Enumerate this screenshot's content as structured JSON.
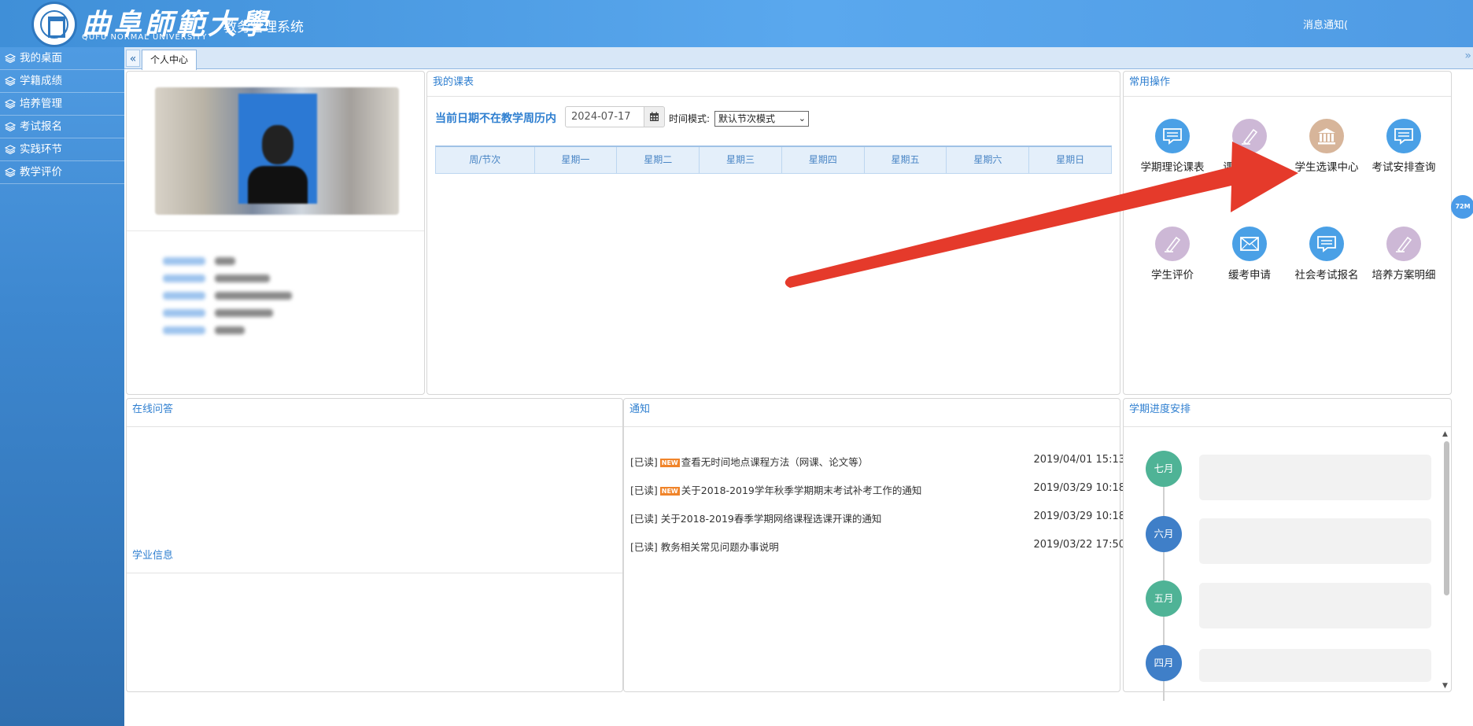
{
  "header": {
    "logo_cn": "曲阜師範大學",
    "logo_en": "QUFU NORMAL UNIVERSITY",
    "system_title": "教务管理系统",
    "message_notice": "消息通知("
  },
  "sidebar": {
    "items": [
      {
        "label": "我的桌面"
      },
      {
        "label": "学籍成绩"
      },
      {
        "label": "培养管理"
      },
      {
        "label": "考试报名"
      },
      {
        "label": "实践环节"
      },
      {
        "label": "教学评价"
      }
    ]
  },
  "tabs": {
    "collapse_glyph": "«",
    "active_label": "个人中心",
    "right_glyph": "»"
  },
  "schedule": {
    "title": "我的课表",
    "week_message": "当前日期不在教学周历内",
    "date_value": "2024-07-17",
    "time_mode_label": "时间模式:",
    "time_mode_selected": "默认节次模式",
    "columns": [
      "周/节次",
      "星期一",
      "星期二",
      "星期三",
      "星期四",
      "星期五",
      "星期六",
      "星期日"
    ]
  },
  "common_ops": {
    "title": "常用操作",
    "items": [
      {
        "label": "学期理论课表",
        "icon": "message-icon",
        "color": "#4aa0e6"
      },
      {
        "label": "课程成绩查",
        "icon": "pen-icon",
        "color": "#cdb8d6"
      },
      {
        "label": "学生选课中心",
        "icon": "bank-icon",
        "color": "#d7b59a"
      },
      {
        "label": "考试安排查询",
        "icon": "message-icon",
        "color": "#4aa0e6"
      },
      {
        "label": "学生评价",
        "icon": "pen-icon",
        "color": "#cdb8d6"
      },
      {
        "label": "缓考申请",
        "icon": "mail-icon",
        "color": "#4aa0e6"
      },
      {
        "label": "社会考试报名",
        "icon": "message-icon",
        "color": "#4aa0e6"
      },
      {
        "label": "培养方案明细",
        "icon": "pen-icon",
        "color": "#cdb8d6"
      }
    ]
  },
  "qa": {
    "title": "在线问答"
  },
  "academic": {
    "title": "学业信息"
  },
  "notices": {
    "title": "通知",
    "items": [
      {
        "status": "[已读]",
        "is_new": true,
        "new_label": "NEW",
        "text": "查看无时间地点课程方法（网课、论文等）",
        "date": "2019/04/01 15:13"
      },
      {
        "status": "[已读]",
        "is_new": true,
        "new_label": "NEW",
        "text": "关于2018-2019学年秋季学期期末考试补考工作的通知",
        "date": "2019/03/29 10:18"
      },
      {
        "status": "[已读]",
        "is_new": false,
        "text": "关于2018-2019春季学期网络课程选课开课的通知",
        "date": "2019/03/29 10:18"
      },
      {
        "status": "[已读]",
        "is_new": false,
        "text": "教务相关常见问题办事说明",
        "date": "2019/03/22 17:50"
      }
    ]
  },
  "semester_progress": {
    "title": "学期进度安排",
    "months": [
      {
        "label": "七月",
        "color": "#4fb396"
      },
      {
        "label": "六月",
        "color": "#3f7fc8"
      },
      {
        "label": "五月",
        "color": "#4fb396"
      },
      {
        "label": "四月",
        "color": "#3f7fc8"
      }
    ]
  },
  "float_badge": "72M"
}
